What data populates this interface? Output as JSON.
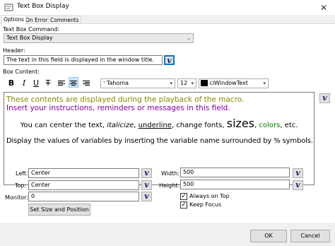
{
  "window": {
    "title": "Text Box Display"
  },
  "tabs": [
    {
      "label": "Options"
    },
    {
      "label": "On Error"
    },
    {
      "label": "Comments"
    }
  ],
  "command": {
    "label": "Text Box Command:",
    "value": "Text Box Display"
  },
  "header": {
    "label": "Header:",
    "value": "The text in this field is displayed in the window title."
  },
  "content": {
    "label": "Box Content:",
    "font_name": "Tahoma",
    "font_size": "12",
    "color_name": "clWindowText",
    "lines": {
      "l1": "These contents are displayed during the playback of the macro.",
      "l2": "Insert your instructions, reminders or messages in this field.",
      "l3_prefix": "You can center the text, ",
      "l3_italic": "italicize",
      "l3_sep1": ", ",
      "l3_underline": "underline",
      "l3_sep2": ", change fonts, ",
      "l3_sizes": "sizes",
      "l3_sep3": ", ",
      "l3_colors": "colors",
      "l3_suffix": ", etc.",
      "l4": "Display the values of variables by inserting the variable name surrounded by % symbols."
    }
  },
  "position": {
    "left_label": "Left:",
    "left_value": "Center",
    "top_label": "Top:",
    "top_value": "Center",
    "width_label": "Width:",
    "width_value": "500",
    "height_label": "Height:",
    "height_value": "500",
    "monitor_label": "Monitor:",
    "monitor_value": "0",
    "set_size_label": "Set Size and Position",
    "always_on_top_label": "Always on Top",
    "keep_focus_label": "Keep Focus"
  },
  "footer": {
    "ok_label": "OK",
    "cancel_label": "Cancel"
  },
  "variable_button_glyph": "v",
  "colors": {
    "olive": "#8a8a00",
    "purple": "#8000a0",
    "green": "#008000",
    "accent": "#0078d7"
  }
}
